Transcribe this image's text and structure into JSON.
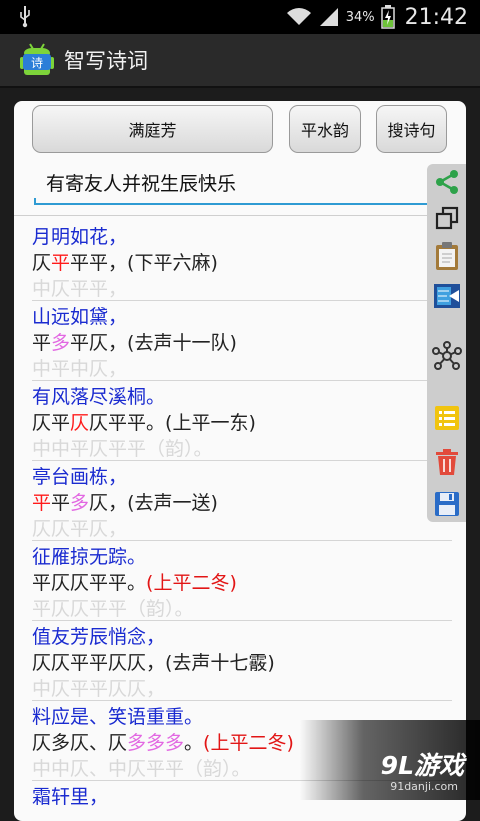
{
  "status": {
    "battery_pct": "34%",
    "time": "21:42"
  },
  "app": {
    "title": "智写诗词"
  },
  "buttons": {
    "tune": "满庭芳",
    "rhyme": "平水韵",
    "search": "搜诗句"
  },
  "poem": {
    "title": "有寄友人并祝生辰快乐"
  },
  "blocks": [
    {
      "text": "月明如花，",
      "pattern": [
        {
          "t": "仄"
        },
        {
          "t": "平",
          "c": "red"
        },
        {
          "t": "平平"
        },
        {
          "t": "，(下平六麻)"
        }
      ],
      "template": "中仄平平，"
    },
    {
      "text": "山远如黛，",
      "pattern": [
        {
          "t": "平"
        },
        {
          "t": "多",
          "c": "pink"
        },
        {
          "t": "平仄"
        },
        {
          "t": "，(去声十一队)"
        }
      ],
      "template": "中平中仄，"
    },
    {
      "text": "有风落尽溪桐。",
      "pattern": [
        {
          "t": "仄平"
        },
        {
          "t": "仄",
          "c": "red"
        },
        {
          "t": "仄平平"
        },
        {
          "t": "。(上平一东)"
        }
      ],
      "template": "中中平仄平平（韵）。"
    },
    {
      "text": "亭台画栋，",
      "pattern": [
        {
          "t": "平",
          "c": "red"
        },
        {
          "t": "平"
        },
        {
          "t": "多",
          "c": "pink"
        },
        {
          "t": "仄"
        },
        {
          "t": "，(去声一送)"
        }
      ],
      "template": "仄仄平仄，"
    },
    {
      "text": "征雁掠无踪。",
      "pattern": [
        {
          "t": "平仄仄平平"
        },
        {
          "t": "。"
        },
        {
          "t": "(上平二冬)",
          "c": "rhymebad"
        }
      ],
      "template": "平仄仄平平（韵）。"
    },
    {
      "text": "值友芳辰悄念，",
      "pattern": [
        {
          "t": "仄仄平平仄仄"
        },
        {
          "t": "，(去声十七霰)"
        }
      ],
      "template": "中仄平平仄仄，"
    },
    {
      "text": "料应是、笑语重重。",
      "pattern": [
        {
          "t": "仄多仄、仄"
        },
        {
          "t": "多多多",
          "c": "pink"
        },
        {
          "t": "。"
        },
        {
          "t": "(上平二冬)",
          "c": "rhymebad"
        }
      ],
      "template": "中中仄、中仄平平（韵）。"
    },
    {
      "text": "霜轩里，",
      "pattern": [],
      "template": ""
    }
  ],
  "tools": [
    "share-icon",
    "copy-icon",
    "clipboard-icon",
    "dictionary-icon",
    "network-icon",
    "list-icon",
    "delete-icon",
    "save-icon"
  ],
  "watermark": {
    "logo": "9L游戏",
    "url": "91danji.com"
  }
}
